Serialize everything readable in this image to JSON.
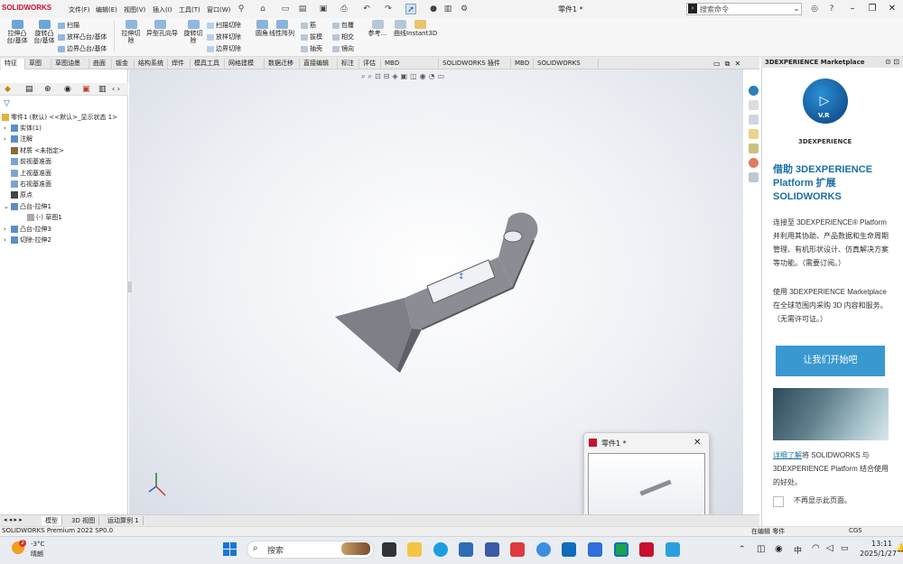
{
  "titlebar": {
    "logo": "SOLIDWORKS",
    "menus": [
      "文件(F)",
      "编辑(E)",
      "视图(V)",
      "插入(I)",
      "工具(T)",
      "窗口(W)"
    ],
    "doc_title": "零件1 *",
    "search_placeholder": "搜索命令"
  },
  "ribbon": {
    "big": [
      {
        "label": "拉伸凸\n台/基体",
        "color": "#6aa6d8"
      },
      {
        "label": "旋转凸\n台/基体",
        "color": "#6aa6d8"
      }
    ],
    "group1": [
      "扫描",
      "放样凸台/基体",
      "边界凸台/基体"
    ],
    "big2": [
      {
        "label": "拉伸切\n除",
        "color": "#8fb7e0"
      },
      {
        "label": "异型孔向导",
        "color": "#8fb7e0"
      },
      {
        "label": "旋转切\n除",
        "color": "#8fb7e0"
      }
    ],
    "group2": [
      "扫描切除",
      "放样切除",
      "边界切除"
    ],
    "big3": [
      {
        "label": "圆角",
        "color": "#8cb4d9"
      },
      {
        "label": "线性阵列",
        "color": "#8cb4d9"
      }
    ],
    "group3": [
      "筋",
      "拔模",
      "抽壳"
    ],
    "group4": [
      "包覆",
      "相交",
      "镜向"
    ],
    "big4": [
      {
        "label": "参考...",
        "color": "#b8c7d6"
      },
      {
        "label": "曲线",
        "color": "#b8c7d6"
      },
      {
        "label": "Instant3D",
        "color": "#e9c46a"
      }
    ]
  },
  "tabs": [
    "特征",
    "草图",
    "草图油墨",
    "曲面",
    "钣金",
    "结构系统",
    "焊件",
    "模具工具",
    "网格建模",
    "数据迁移",
    "直接编辑",
    "标注",
    "评估",
    "MBD Dimensions",
    "SOLIDWORKS 插件",
    "MBD",
    "SOLIDWORKS CAM"
  ],
  "tree": {
    "root": "零件1 (默认) <<默认>_显示状态 1>",
    "items": [
      {
        "label": "实体(1)",
        "indent": 1,
        "expander": "›"
      },
      {
        "label": "注解",
        "indent": 1,
        "expander": "›"
      },
      {
        "label": "材质 <未指定>",
        "indent": 1,
        "expander": ""
      },
      {
        "label": "前视基准面",
        "indent": 1,
        "expander": ""
      },
      {
        "label": "上视基准面",
        "indent": 1,
        "expander": ""
      },
      {
        "label": "右视基准面",
        "indent": 1,
        "expander": ""
      },
      {
        "label": "原点",
        "indent": 1,
        "expander": ""
      },
      {
        "label": "凸台-拉伸1",
        "indent": 1,
        "expander": "⌄"
      },
      {
        "label": "(-) 草图1",
        "indent": 2,
        "expander": ""
      },
      {
        "label": "凸台-拉伸3",
        "indent": 1,
        "expander": "›"
      },
      {
        "label": "切除-拉伸2",
        "indent": 1,
        "expander": "›"
      }
    ]
  },
  "view_tabs": [
    "模型",
    "3D 视图",
    "运动算例 1"
  ],
  "status": {
    "left": "SOLIDWORKS Premium 2022 SP0.0",
    "editing": "在编辑 零件",
    "units": "CGS"
  },
  "panel": {
    "header": "3DEXPERIENCE Marketplace",
    "brand": "3DEXPERIENCE",
    "logo_text": "V.R",
    "title": "借助 3DEXPERIENCE Platform 扩展 SOLIDWORKS",
    "p1": "连接至 3DEXPERIENCE® Platform 并利用其协助、产品数据和生命周期管理、有机形状设计、仿真解决方案等功能。（需要订阅。）",
    "p2": "使用 3DEXPERIENCE Marketplace 在全球范围内采购 3D 内容和服务。（无需许可证。）",
    "button": "让我们开始吧",
    "learn_link": "详细了解",
    "learn_rest": "将 SOLIDWORKS 与 3DEXPERIENCE Platform 结合使用的好处。",
    "dont_show": "不再显示此页面。"
  },
  "thumbnail": {
    "title": "零件1 *"
  },
  "taskbar": {
    "weather_temp": "-3°C",
    "weather_desc": "晴朗",
    "weather_badge": "2",
    "search": "搜索",
    "lang": "中",
    "time": "13:11",
    "date": "2025/1/27"
  },
  "colors": {
    "accent": "#3a98d0",
    "brand_red": "#c8102e",
    "model": "#8a8d94"
  }
}
